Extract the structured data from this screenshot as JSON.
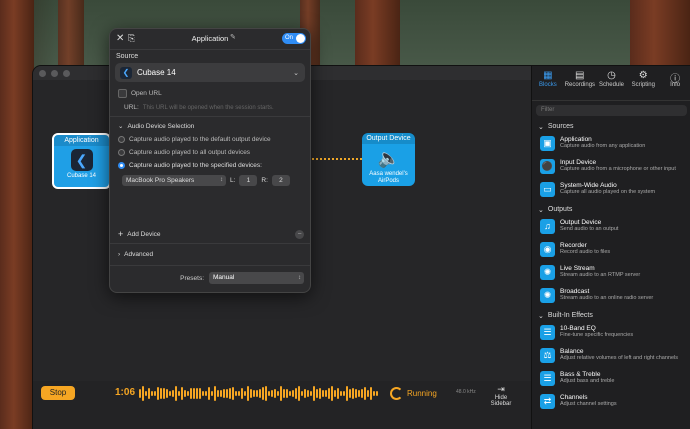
{
  "popup": {
    "title": "Application",
    "toggle": "On",
    "source_label": "Source",
    "selected_app": "Cubase 14",
    "open_url_label": "Open URL",
    "url_label": "URL:",
    "url_placeholder": "This URL will be opened when the session starts.",
    "audio_section": "Audio Device Selection",
    "options": [
      "Capture audio played to the default output device",
      "Capture audio played to all output devices",
      "Capture audio played to the specified devices:"
    ],
    "device": "MacBook Pro Speakers",
    "left_label": "L:",
    "left_value": "1",
    "right_label": "R:",
    "right_value": "2",
    "add_device": "Add Device",
    "advanced": "Advanced",
    "presets_label": "Presets:",
    "presets_value": "Manual"
  },
  "canvas": {
    "app_node_title": "Application",
    "app_node_label": "Cubase 14",
    "out_node_title": "Output Device",
    "out_node_label": "Aasa wendel's AirPods"
  },
  "bottombar": {
    "stop": "Stop",
    "time": "1:06",
    "status": "Running",
    "rate": "48.0 kHz",
    "hide_sidebar": "Hide Sidebar"
  },
  "sidebar": {
    "tabs": [
      "Blocks",
      "Recordings",
      "Schedule",
      "Scripting",
      "Info"
    ],
    "filter_placeholder": "Filter",
    "sections": [
      {
        "title": "Sources",
        "items": [
          {
            "name": "Application",
            "desc": "Capture audio from any application"
          },
          {
            "name": "Input Device",
            "desc": "Capture audio from a microphone or other input"
          },
          {
            "name": "System-Wide Audio",
            "desc": "Capture all audio played on the system"
          }
        ]
      },
      {
        "title": "Outputs",
        "items": [
          {
            "name": "Output Device",
            "desc": "Send audio to an output"
          },
          {
            "name": "Recorder",
            "desc": "Record audio to files"
          },
          {
            "name": "Live Stream",
            "desc": "Stream audio to an RTMP server"
          },
          {
            "name": "Broadcast",
            "desc": "Stream audio to an online radio server"
          }
        ]
      },
      {
        "title": "Built-In Effects",
        "items": [
          {
            "name": "10-Band EQ",
            "desc": "Fine-tune specific frequencies"
          },
          {
            "name": "Balance",
            "desc": "Adjust relative volumes of left and right channels"
          },
          {
            "name": "Bass & Treble",
            "desc": "Adjust bass and treble"
          },
          {
            "name": "Channels",
            "desc": "Adjust channel settings"
          }
        ]
      }
    ]
  },
  "colors": {
    "accent": "#f6a623",
    "blue": "#1aa0e6"
  }
}
